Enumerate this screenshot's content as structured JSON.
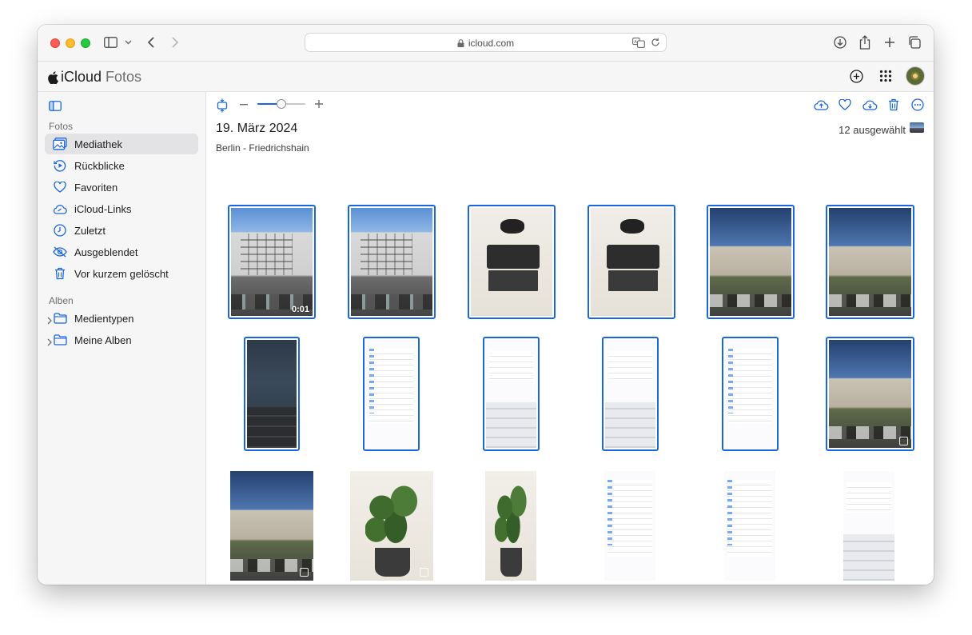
{
  "browser": {
    "url": "icloud.com"
  },
  "app": {
    "brand_name": "iCloud",
    "brand_suffix": "Fotos"
  },
  "sidebar": {
    "section_fotos": "Fotos",
    "items": [
      {
        "label": "Mediathek",
        "icon": "photo-library-icon",
        "selected": true
      },
      {
        "label": "Rückblicke",
        "icon": "memories-icon"
      },
      {
        "label": "Favoriten",
        "icon": "heart-icon"
      },
      {
        "label": "iCloud-Links",
        "icon": "cloud-link-icon"
      },
      {
        "label": "Zuletzt",
        "icon": "clock-icon"
      },
      {
        "label": "Ausgeblendet",
        "icon": "eye-slash-icon"
      },
      {
        "label": "Vor kurzem gelöscht",
        "icon": "trash-icon"
      }
    ],
    "section_alben": "Alben",
    "albums": [
      {
        "label": "Medientypen",
        "icon": "folder-icon"
      },
      {
        "label": "Meine Alben",
        "icon": "folder-icon"
      }
    ]
  },
  "content": {
    "date_title": "19. März 2024",
    "location": "Berlin - Friedrichshain",
    "selection_count": "12 ausgewählt",
    "zoom_level": 0.5,
    "video_duration": "0:01"
  },
  "colors": {
    "selection": "#1a66e0",
    "accent": "#1a66e0"
  }
}
